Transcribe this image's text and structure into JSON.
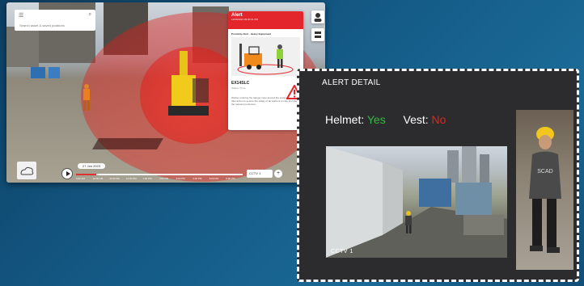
{
  "app": {
    "search_placeholder": "Search asset & saved positions"
  },
  "alert": {
    "title": "Alert",
    "subtitle": "12/05/2023 09:00:01 PM",
    "category": "Proximity Alert - Heavy Equipment",
    "equipment_id": "EX14SLC",
    "meta": "Status / Time",
    "description": "Worker entering the danger zone around the excavator. Please take action to ensure the safety of all workers on site and alert the relevant personnel."
  },
  "timeline": {
    "date": "27 Jan 2023",
    "progress": 0.12,
    "labels": [
      "9:00 AM",
      "10:00 AM",
      "11:00 AM",
      "12:00 PM",
      "1:00 PM",
      "2:00 PM",
      "3:00 PM",
      "4:00 PM",
      "5:00 PM",
      "6:00 PM"
    ]
  },
  "camera_select": "CCTV 1",
  "detail": {
    "title": "ALERT DETAIL",
    "helmet_label": "Helmet:",
    "helmet_value": "Yes",
    "vest_label": "Vest:",
    "vest_value": "No",
    "cctv_label": "CCTV 1",
    "shirt_text": "SCAD"
  },
  "colors": {
    "accent": "#e3262b",
    "yes": "#2fbf3a",
    "no": "#e0261f",
    "background": "#145a86"
  },
  "icons": [
    "menu-icon",
    "search-icon",
    "user-icon",
    "layers-icon",
    "play-icon",
    "chat-icon",
    "warning-icon",
    "plus-icon",
    "cloud-logo-icon"
  ]
}
